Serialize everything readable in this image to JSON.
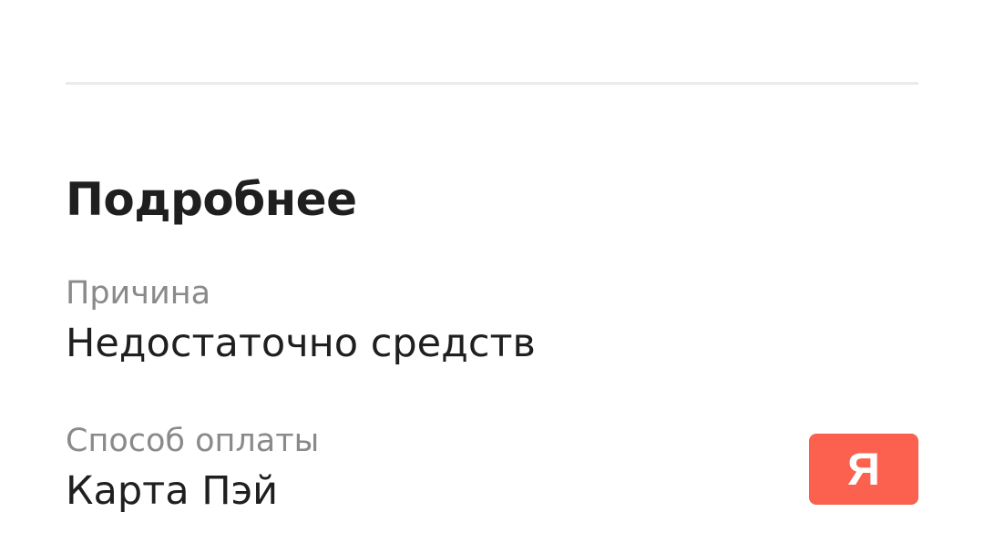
{
  "details": {
    "title": "Подробнее",
    "reason": {
      "label": "Причина",
      "value": "Недостаточно средств"
    },
    "payment_method": {
      "label": "Способ оплаты",
      "value": "Карта Пэй",
      "logo_text": "Я",
      "logo_color": "#fc6150"
    }
  }
}
